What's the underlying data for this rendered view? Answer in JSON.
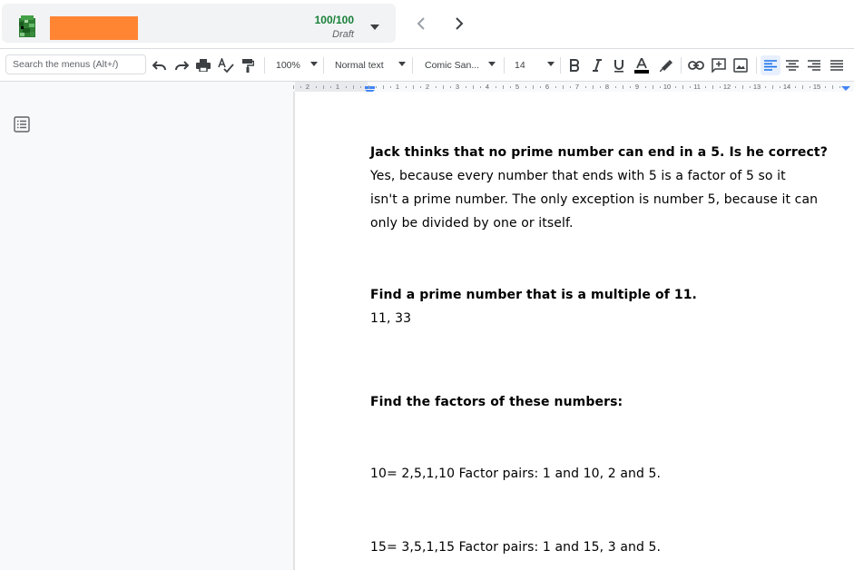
{
  "header": {
    "score": "100/100",
    "status": "Draft",
    "colors": {
      "name_block": "#ff8533",
      "score": "#188038",
      "accent": "#1a73e8"
    }
  },
  "toolbar": {
    "search_placeholder": "Search the menus (Alt+/)",
    "zoom": "100%",
    "style": "Normal text",
    "font": "Comic San...",
    "font_size": "14"
  },
  "ruler": {
    "labels": [
      "2",
      "1",
      "1",
      "2",
      "3",
      "4",
      "5",
      "6",
      "7",
      "8",
      "9",
      "10",
      "11",
      "12",
      "13",
      "14",
      "15"
    ]
  },
  "document": {
    "q1": "Jack thinks that no prime number can end in a 5. Is he correct?",
    "a1_line1": "Yes, because every number that ends with 5 is a factor of 5 so it",
    "a1_line2": "isn't a prime number. The only exception is number 5, because it can",
    "a1_line3": "only be divided by one or itself.",
    "q2": "Find a prime number that is a multiple of 11.",
    "a2": "11, 33",
    "q3": "Find the factors of these numbers:",
    "a3_line1": "10= 2,5,1,10 Factor pairs: 1 and 10, 2 and 5.",
    "a3_line2": "15=  3,5,1,15 Factor pairs: 1 and 15, 3 and 5."
  },
  "icons": [
    "avatar-icon",
    "chevron-down-icon",
    "chevron-left-icon",
    "chevron-right-icon",
    "undo-icon",
    "redo-icon",
    "print-icon",
    "spellcheck-icon",
    "paint-format-icon",
    "bold-icon",
    "italic-icon",
    "underline-icon",
    "text-color-icon",
    "highlight-icon",
    "link-icon",
    "comment-icon",
    "image-icon",
    "align-left-icon",
    "align-center-icon",
    "align-right-icon",
    "justify-icon",
    "outline-icon"
  ]
}
